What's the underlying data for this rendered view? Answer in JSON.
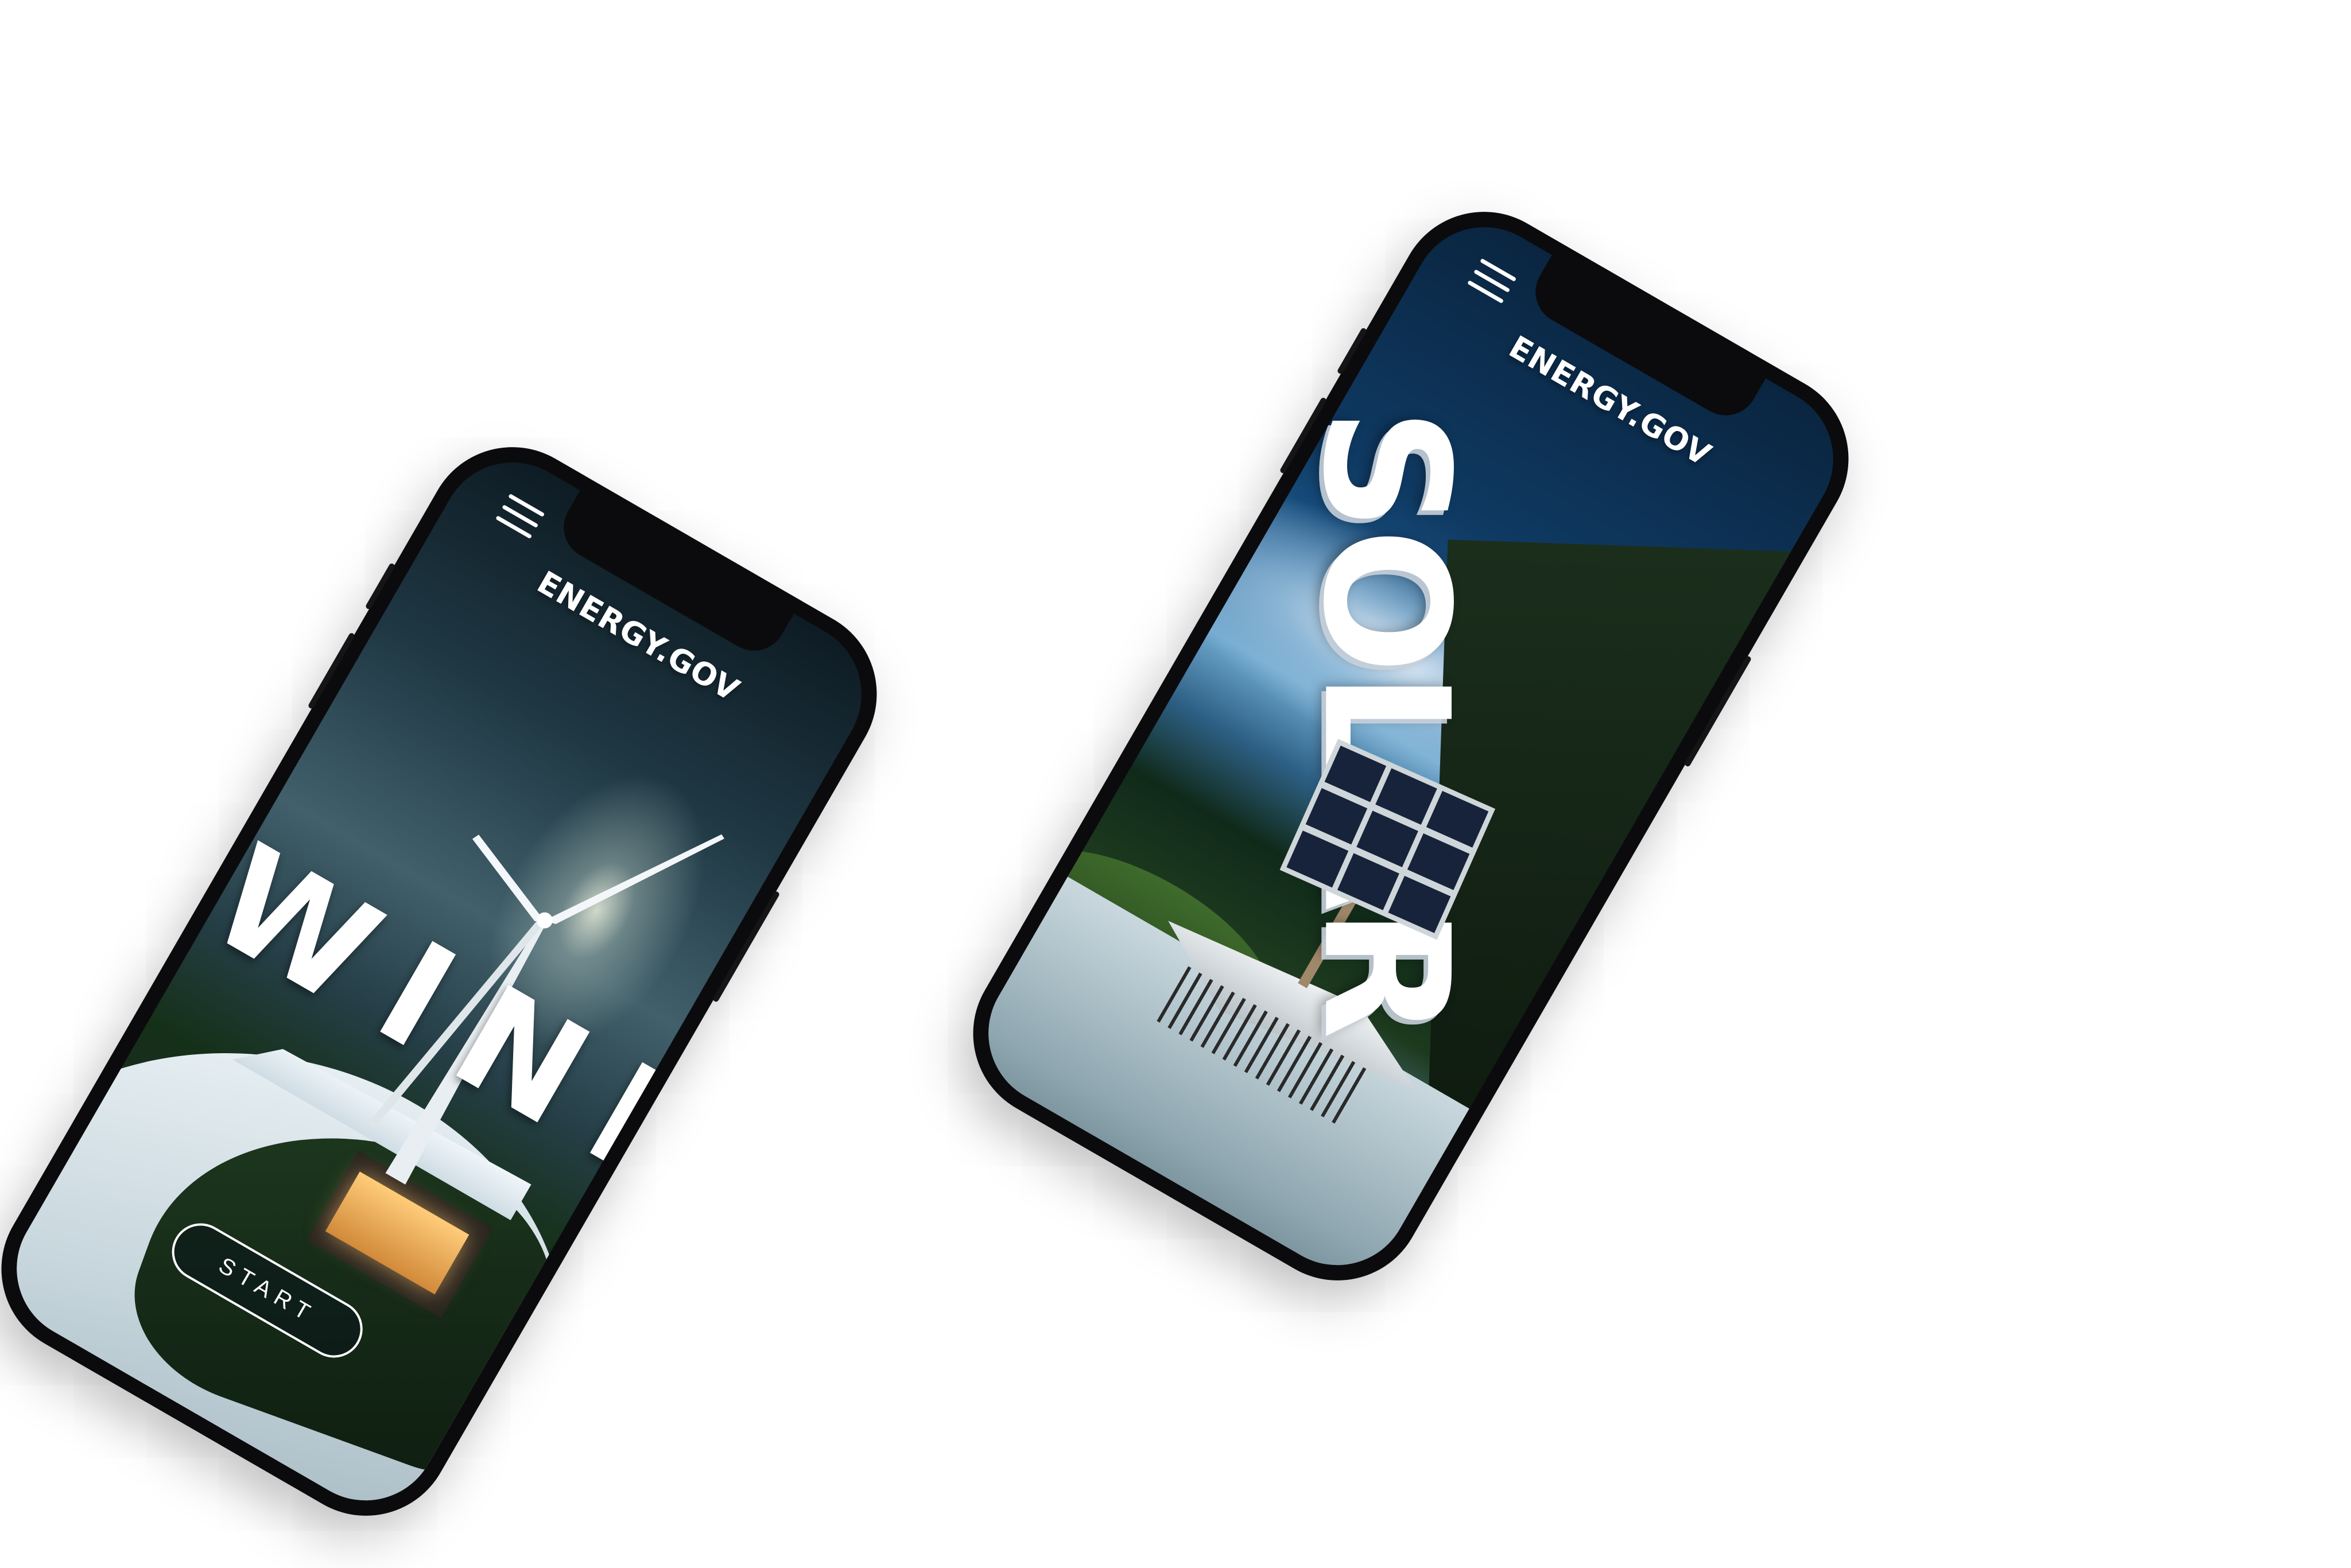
{
  "brand": "ENERGY.GOV",
  "screens": {
    "wind": {
      "title": "WIND",
      "cta_label": "START"
    },
    "solar": {
      "title": "SOLAR"
    }
  },
  "icons": {
    "menu": "hamburger-menu-icon"
  },
  "colors": {
    "phone_frame": "#0b0b0d",
    "text": "#ffffff",
    "background": "#ffffff"
  }
}
